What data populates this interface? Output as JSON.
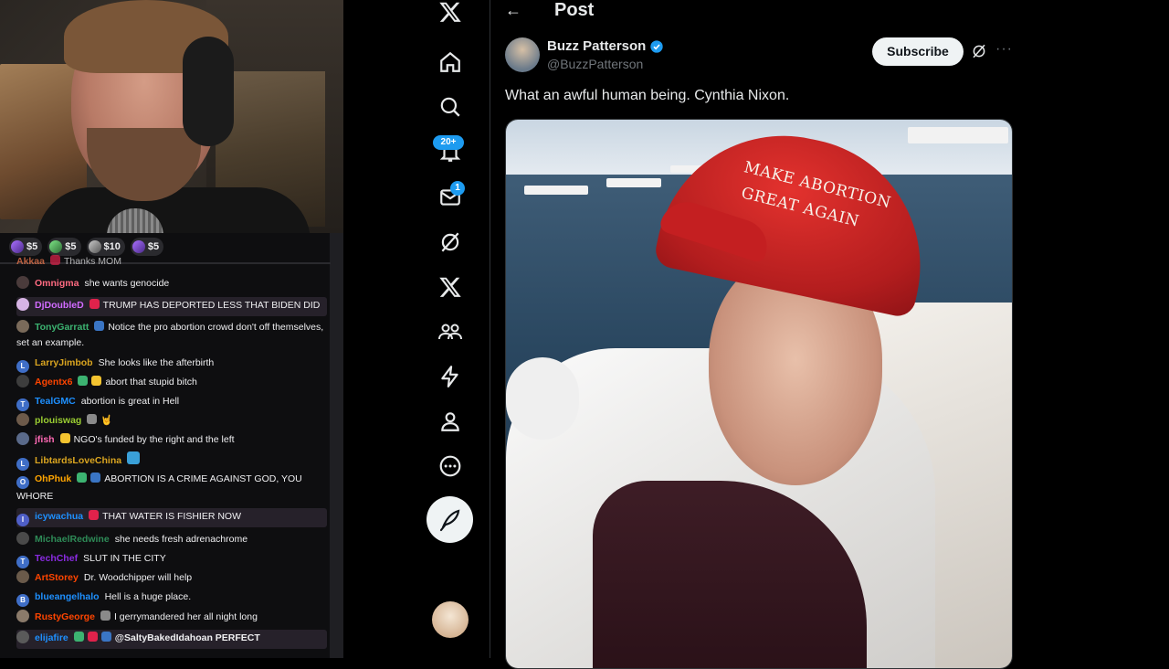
{
  "stream": {
    "donation_badges": [
      {
        "amount": "$5"
      },
      {
        "amount": "$5"
      },
      {
        "amount": "$10"
      },
      {
        "amount": "$5"
      }
    ],
    "chat": [
      {
        "user": "Akkaa",
        "color": "#ff7f50",
        "text": "Thanks MOM",
        "initial": ""
      },
      {
        "user": "Omnigma",
        "color": "#ff6b81",
        "text": "she wants genocide",
        "initial": ""
      },
      {
        "user": "DjDoubleD",
        "color": "#d16bff",
        "text": "TRUMP HAS DEPORTED LESS THAT BIDEN DID",
        "initial": ""
      },
      {
        "user": "TonyGarratt",
        "color": "#3cb371",
        "text": "Notice the pro abortion crowd don't off themselves, set an example.",
        "initial": ""
      },
      {
        "user": "LarryJimbob",
        "color": "#daa520",
        "text": "She looks like the afterbirth",
        "initial": "L"
      },
      {
        "user": "Agentx6",
        "color": "#ff4500",
        "text": "abort that stupid bitch",
        "initial": ""
      },
      {
        "user": "TealGMC",
        "color": "#1e90ff",
        "text": "abortion is great in Hell",
        "initial": "T"
      },
      {
        "user": "plouiswag",
        "color": "#9acd32",
        "text": "🤘",
        "initial": ""
      },
      {
        "user": "jfish",
        "color": "#ff69b4",
        "text": "NGO's funded by the right and the left",
        "initial": ""
      },
      {
        "user": "LibtardsLoveChina",
        "color": "#daa520",
        "text": "",
        "initial": "L"
      },
      {
        "user": "OhPhuk",
        "color": "#ffa500",
        "text": "ABORTION IS A CRIME AGAINST GOD, YOU WHORE",
        "initial": "O"
      },
      {
        "user": "icywachua",
        "color": "#1e90ff",
        "text": "THAT WATER IS FISHIER NOW",
        "initial": "I"
      },
      {
        "user": "MichaelRedwine",
        "color": "#2e8b57",
        "text": "she needs fresh adrenachrome",
        "initial": ""
      },
      {
        "user": "TechChef",
        "color": "#8a2be2",
        "text": "SLUT IN THE CITY",
        "initial": "T"
      },
      {
        "user": "ArtStorey",
        "color": "#ff4500",
        "text": "Dr. Woodchipper will help",
        "initial": ""
      },
      {
        "user": "blueangelhalo",
        "color": "#1e90ff",
        "text": "Hell is a huge place.",
        "initial": "B"
      },
      {
        "user": "RustyGeorge",
        "color": "#ff4500",
        "text": "I gerrymandered her all night long",
        "initial": ""
      },
      {
        "user": "elijafire",
        "color": "#1e90ff",
        "text": "@SaltyBakedIdahoan PERFECT",
        "initial": ""
      }
    ]
  },
  "x": {
    "notifications_badge": "20+",
    "messages_badge": "1"
  },
  "post": {
    "header_title": "Post",
    "author_name": "Buzz Patterson",
    "author_handle": "@BuzzPatterson",
    "subscribe_label": "Subscribe",
    "more_label": "···",
    "text": "What an awful human being. Cynthia Nixon.",
    "image_hat_text_line1": "MAKE ABORTION",
    "image_hat_text_line2": "GREAT AGAIN"
  },
  "colors": {
    "x_blue": "#1d9bf0",
    "chat_bg": "#0e0e10",
    "hat_red": "#c41f21"
  }
}
